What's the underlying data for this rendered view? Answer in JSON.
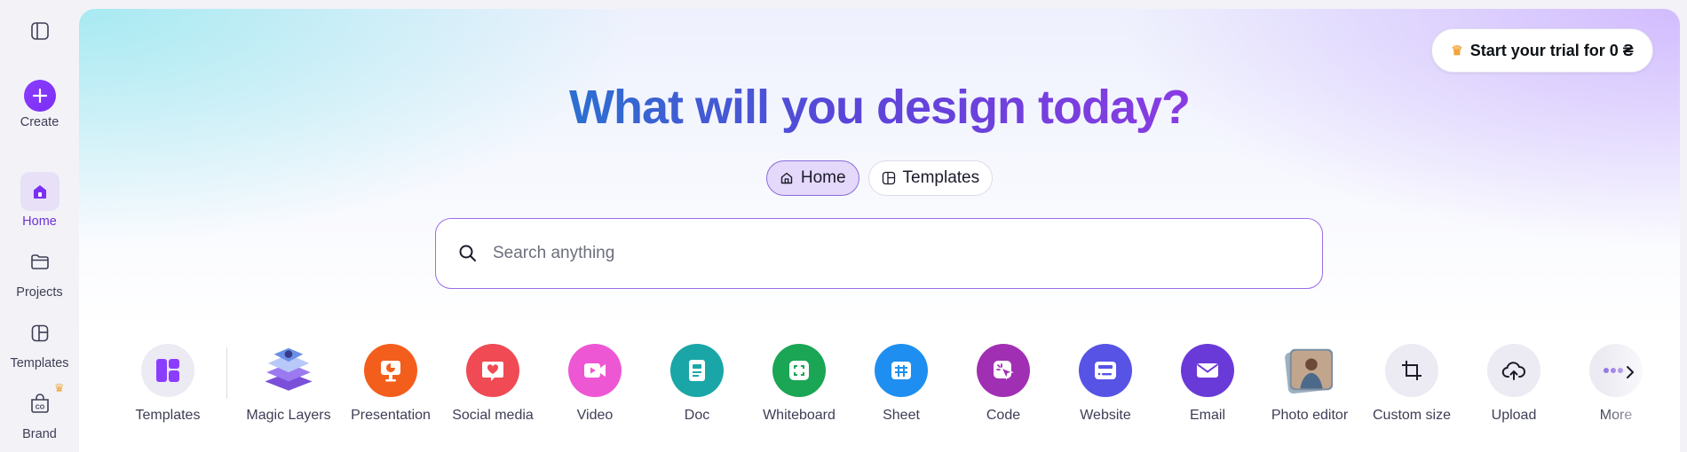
{
  "sidebar": {
    "toggle_icon": "sidebar-toggle-icon",
    "items": [
      {
        "label": "Create",
        "icon": "plus-icon"
      },
      {
        "label": "Home",
        "icon": "home-icon"
      },
      {
        "label": "Projects",
        "icon": "folder-icon"
      },
      {
        "label": "Templates",
        "icon": "templates-icon"
      },
      {
        "label": "Brand",
        "icon": "brand-icon"
      }
    ]
  },
  "header": {
    "trial_label": "Start your trial for 0 ₴",
    "headline": "What will you design today?"
  },
  "tabs": [
    {
      "label": "Home",
      "icon": "home-icon"
    },
    {
      "label": "Templates",
      "icon": "templates-icon"
    }
  ],
  "search": {
    "placeholder": "Search anything"
  },
  "shortcuts": [
    {
      "label": "Templates",
      "color": "#f0eff4"
    },
    {
      "label": "Magic Layers",
      "color": "#ffffff"
    },
    {
      "label": "Presentation",
      "color": "#f45e1d"
    },
    {
      "label": "Social media",
      "color": "#f04a54"
    },
    {
      "label": "Video",
      "color": "#ee57d3"
    },
    {
      "label": "Doc",
      "color": "#1aa6a6"
    },
    {
      "label": "Whiteboard",
      "color": "#1ba655"
    },
    {
      "label": "Sheet",
      "color": "#1e8ff0"
    },
    {
      "label": "Code",
      "color": "#a12fb3"
    },
    {
      "label": "Website",
      "color": "#5753e5"
    },
    {
      "label": "Email",
      "color": "#6a3ad8"
    },
    {
      "label": "Photo editor",
      "color": "#ffffff"
    },
    {
      "label": "Custom size",
      "color": "#f0eff4"
    },
    {
      "label": "Upload",
      "color": "#f0eff4"
    },
    {
      "label": "More",
      "color": "#f0eff4"
    }
  ],
  "colors": {
    "accent": "#8b3dff",
    "active_bg": "#e4d8fb"
  }
}
